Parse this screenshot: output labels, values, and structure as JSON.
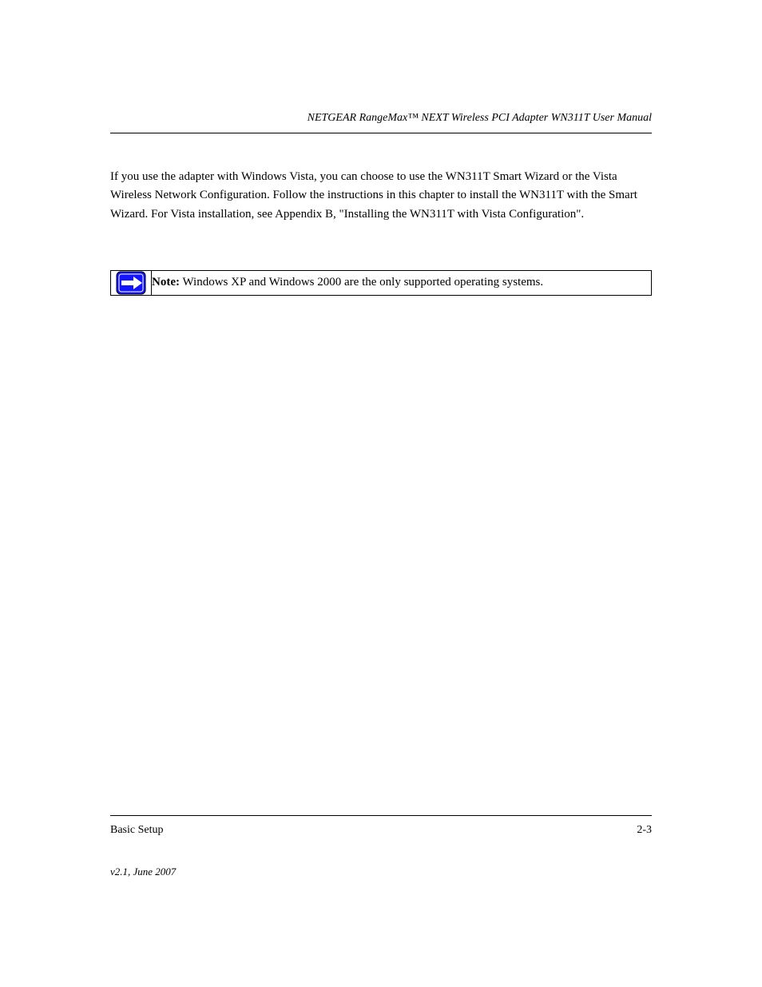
{
  "header": {
    "title": "NETGEAR RangeMax™ NEXT Wireless PCI Adapter WN311T User Manual"
  },
  "body": {
    "intro": "If you use the adapter with Windows Vista, you can choose to use the WN311T Smart Wizard or the Vista Wireless Network Configuration. Follow the instructions in this chapter to install the WN311T with the Smart Wizard. For Vista installation, see Appendix B, \"Installing the WN311T with Vista Configuration\".",
    "note_label": "Note:",
    "note_text": "Windows XP and Windows 2000 are the only supported operating systems."
  },
  "footer": {
    "left": "Basic Setup",
    "right": "2-3",
    "version": "v2.1, June 2007"
  }
}
